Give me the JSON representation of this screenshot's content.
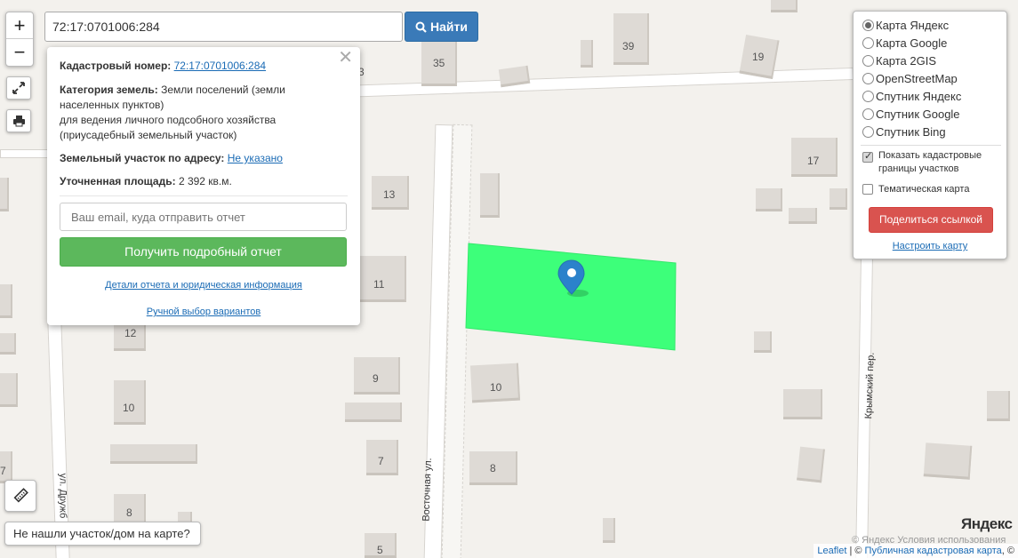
{
  "map": {
    "house_numbers": [
      "39",
      "35",
      "19",
      "3",
      "17",
      "13",
      "11",
      "12",
      "9",
      "10",
      "10",
      "7",
      "8",
      "8",
      "5",
      "7"
    ],
    "streets": {
      "vostochnaya": "Восточная ул.",
      "druzhby": "ул. Дружб",
      "krymsky": "Крымский пер."
    },
    "parcel_color": "#3dff7a",
    "marker_color": "#2b82cb"
  },
  "controls": {
    "zoom_in": "+",
    "zoom_out": "−",
    "fullscreen_icon": "expand-icon",
    "print_icon": "print-icon",
    "ruler_icon": "ruler-icon"
  },
  "search": {
    "value": "72:17:0701006:284",
    "button_label": "Найти"
  },
  "popup": {
    "cad_label": "Кадастровый номер:",
    "cad_value": "72:17:0701006:284",
    "cat_label": "Категория земель:",
    "cat_value": "Земли поселений (земли населенных пунктов)",
    "cat_use": "для ведения личного подсобного хозяйства (приусадебный земельный участок)",
    "addr_label": "Земельный участок по адресу:",
    "addr_value": "Не указано",
    "area_label": "Уточненная площадь:",
    "area_value": "2 392 кв.м.",
    "email_placeholder": "Ваш email, куда отправить отчет",
    "report_button": "Получить подробный отчет",
    "details_link": "Детали отчета и юридическая информация",
    "manual_link": "Ручной выбор вариантов"
  },
  "layers": {
    "options": [
      "Карта Яндекс",
      "Карта Google",
      "Карта 2GIS",
      "OpenStreetMap",
      "Спутник Яндекс",
      "Спутник Google",
      "Спутник Bing"
    ],
    "selected": "Карта Яндекс",
    "show_borders": "Показать кадастровые границы участков",
    "thematic": "Тематическая карта",
    "share_button": "Поделиться ссылкой",
    "setup_link": "Настроить карту"
  },
  "not_found_button": "Не нашли участок/дом на карте?",
  "attribution": {
    "leaflet": "Leaflet",
    "sep": " | © ",
    "pkk": "Публичная кадастровая карта",
    "tail": ", ©",
    "yandex_terms": "© Яндекс Условия использования"
  },
  "yandex_logo": "Яндекс"
}
